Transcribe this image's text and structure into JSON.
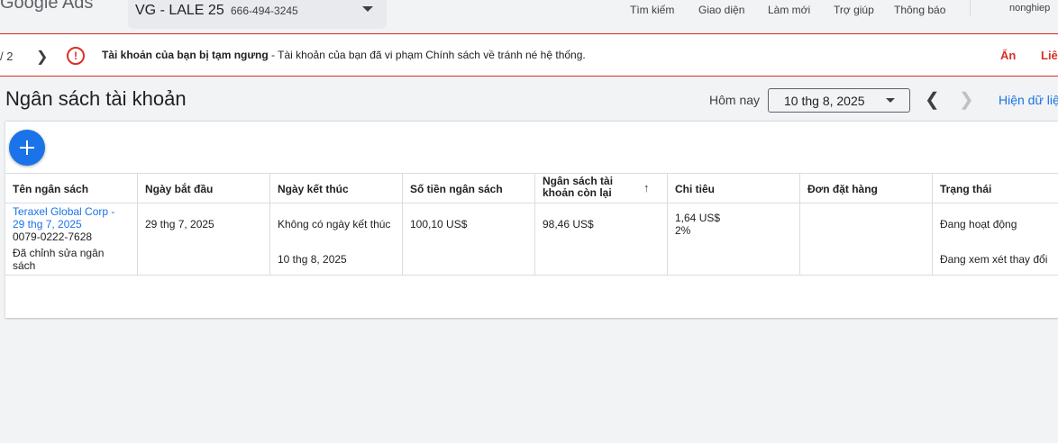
{
  "topbar": {
    "logo": "Google Ads",
    "account_name": "VG - LALE 25",
    "account_id": "666-494-3245",
    "nav": [
      "Tìm kiếm",
      "Giao diện",
      "Làm mới",
      "Trợ giúp",
      "Thông báo"
    ],
    "user": "nonghiep"
  },
  "alert": {
    "pager": "/ 2",
    "title": "Tài khoản của bạn bị tạm ngưng",
    "message": " - Tài khoản của bạn đã vi phạm Chính sách về tránh né hệ thống.",
    "hide": "Ẩn",
    "more": "Liê"
  },
  "header": {
    "title": "Ngân sách tài khoản",
    "date_label": "Hôm nay",
    "date_value": "10 thg 8, 2025",
    "show_data": "Hiện dữ liệ"
  },
  "table": {
    "columns": [
      "Tên ngân sách",
      "Ngày bắt đầu",
      "Ngày kết thúc",
      "Số tiền ngân sách",
      "Ngân sách tài khoản còn lại",
      "Chi tiêu",
      "Đơn đặt hàng",
      "Trạng thái"
    ],
    "row": {
      "name_line1": "Teraxel Global Corp -",
      "name_line2": "29 thg 7, 2025",
      "name_id": "0079-0222-7628",
      "name_edit1": "Đã chỉnh sửa ngân",
      "name_edit2": "sách",
      "start": "29 thg 7, 2025",
      "end_current": "Không có ngày kết thúc",
      "end_pending": "10 thg 8, 2025",
      "amount": "100,10 US$",
      "remaining": "98,46 US$",
      "spend": "1,64 US$",
      "spend_pct": "2%",
      "orders": "",
      "status": "Đang hoạt động",
      "status_pending": "Đang xem xét thay đổi"
    }
  },
  "colors": {
    "accent": "#1a73e8",
    "error": "#d93025"
  },
  "icons": [
    "plus-icon",
    "error-icon",
    "chevron-right-icon",
    "chevron-left-icon",
    "arrow-up-icon",
    "caret-down-icon"
  ]
}
